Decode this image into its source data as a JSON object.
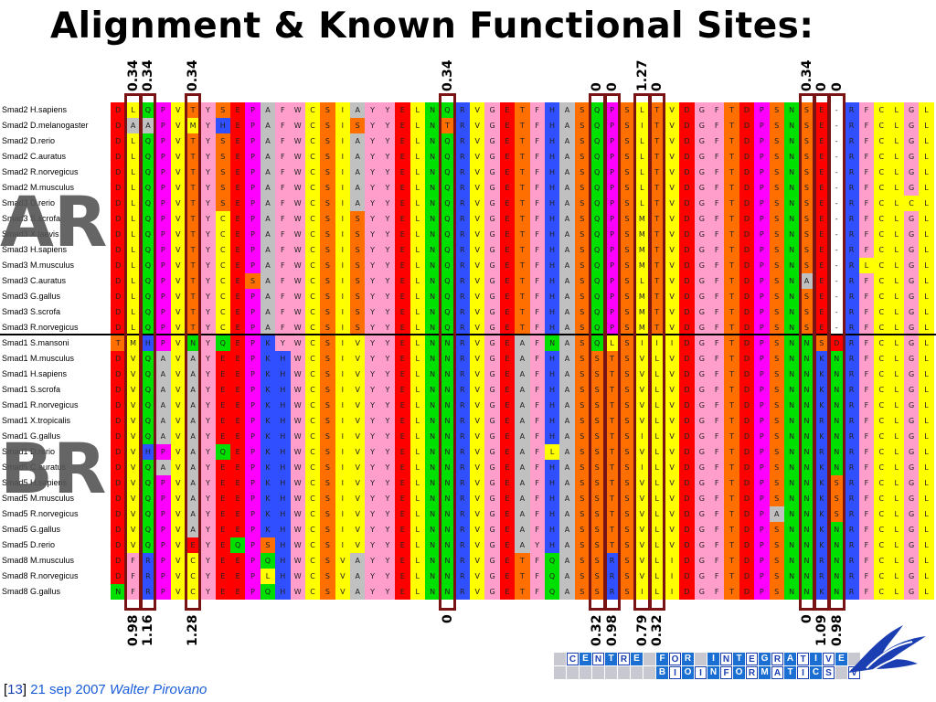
{
  "slide": {
    "title": "Alignment & Known Functional Sites:",
    "group_labels": [
      "AR",
      "BR"
    ],
    "footer": {
      "bracket_open": "[",
      "slide_number": "13",
      "bracket_close": "]",
      "date": "21 sep 2007",
      "author": "Walter Pirovano"
    },
    "logo": {
      "row1": "CENTRE FOR INTEGRATIVE",
      "row2": "BIOINFORMATICS VU"
    }
  },
  "colors": {
    "D": "#ff0000",
    "E": "#ff0000",
    "L": "#ffff00",
    "I": "#ffff00",
    "V": "#ffff00",
    "M": "#ffff00",
    "Q": "#00e000",
    "N": "#00e000",
    "P": "#ff00ff",
    "T": "#ff6f00",
    "S": "#ff6f00",
    "A": "#c0c0c0",
    "C": "#ffff00",
    "F": "#ff9ecb",
    "W": "#ff9ecb",
    "Y": "#ff9ecb",
    "R": "#3050ff",
    "K": "#3050ff",
    "H": "#3050ff",
    "G": "#ff9ecb",
    "-": "#ffffff"
  },
  "alignment": {
    "sequences": [
      {
        "name": "Smad2 H.sapiens",
        "seq": "DLQPVTYSEPAFWCSIAYYELNQRVGETFHASQPSLTVDGFTDPSNSE-RFCLGL"
      },
      {
        "name": "Smad2 D.melanogaster",
        "seq": "DAAPVMYHEPAFWCSISYYELNTRVGETFHASQPSITVDGFTDPSNSE-RFCLGL"
      },
      {
        "name": "Smad2 D.rerio",
        "seq": "DLQPVTYSEPAFWCSIAYYELNQRVGETFHASQPSLTVDGFTDPSNSE-RFCLGL"
      },
      {
        "name": "Smad2 C.auratus",
        "seq": "DLQPVTYSEPAFWCSIAYYELNQRVGETFHASQPSLTVDGFTDPSNSE-RFCLGL"
      },
      {
        "name": "Smad2 R.norvegicus",
        "seq": "DLQPVTYSEPAFWCSIAYYELNQRVGETFHASQPSLTVDGFTDPSNSE-RFCLGL"
      },
      {
        "name": "Smad2 M.musculus",
        "seq": "DLQPVTYSEPAFWCSIAYYELNQRVGETFHASQPSLTVDGFTDPSNSE-RFCLGL"
      },
      {
        "name": "Smad3 D.rerio",
        "seq": "DLQPVTYSEPAFWCSIAYYELNQRVGETFHASQPSLTVDGFTDPSNSE-RFCLCL"
      },
      {
        "name": "Smad3 S.scrofa",
        "seq": "DLQPVTYCEPAFWCSISYYELNQRVGETFHASQPSMTVDGFTDPSNSE-RFCLGL"
      },
      {
        "name": "Smad3 X.laevis",
        "seq": "DLQPVTYCEPAFWCSISYYELNQRVGETFHASQPSMTVDGFTDPSNSE-RFCLGL"
      },
      {
        "name": "Smad3 H.sapiens",
        "seq": "DLQPVTYCEPAFWCSISYYELNQRVGETFHASQPSMTVDGFTDPSNSE-RFCLGL"
      },
      {
        "name": "Smad3 M.musculus",
        "seq": "DLQPVTYCEPAFWCSISYYELNQRVGETFHASQPSMTVDGFTDPSNSE-RLCLGL"
      },
      {
        "name": "Smad3 C.auratus",
        "seq": "DLQPVTYCESAFWCSISYYELNQRVGETFHASQPSLTVDGFTDPSNAE-RFCLGL"
      },
      {
        "name": "Smad3 G.gallus",
        "seq": "DLQPVTYCEPAFWCSISYYELNQRVGETFHASQPSMTVDGFTDPSNSE-RFCLGL"
      },
      {
        "name": "Smad3 S.scrofa",
        "seq": "DLQPVTYCEPAFWCSISYYELNQRVGETFHASQPSMTVDGFTDPSNSE-RFCLGL"
      },
      {
        "name": "Smad3 R.norvegicus",
        "seq": "DLQPVTYCEPAFWCSISYYELNQRVGETFHASQPSMTVDGFTDPSNSE-RFCLGL"
      },
      {
        "name": "Smad1 S.mansoni",
        "seq": "TMHPVNYQEPKYWCSIVYYELNNRVGEAFNASQLSIIIDGFTDPSNNSDRFCLGL"
      },
      {
        "name": "Smad1 M.musculus",
        "seq": "DVQAVAYEEPKHWCSIVYYELNNRVGEAFHASSTSVLVDGFTDPSNNKNRFCLGL"
      },
      {
        "name": "Smad1 H.sapiens",
        "seq": "DVQAVAYEEPKHWCSIVYYELNNRVGEAFHASSTSVLVDGFTDPSNNKNRFCLGL"
      },
      {
        "name": "Smad1 S.scrofa",
        "seq": "DVQAVAYEEPKHWCSIVYYELNNRVGEAFHASSTSVLVDGFTDPSNNKNRFCLGL"
      },
      {
        "name": "Smad1 R.norvegicus",
        "seq": "DVQAVAYEEPKHWCSIVYYELNNRVGEAFHASSTSVLVDGFTDPSNNKNRFCLGL"
      },
      {
        "name": "Smad1 X.tropicalis",
        "seq": "DVQAVAYEEPKHWCSIVYYELNNRVGEAFHASSTSVLVDGFTDPSNNRNRFCLGL"
      },
      {
        "name": "Smad1 G.gallus",
        "seq": "DVQAVAYEEPKHWCSIVYYELNNRVGEAFHASSTSILVDGFTDPSNNKNRFCLGL"
      },
      {
        "name": "Smad1 D.rerio",
        "seq": "DVHPVAYQEPKHWCSIVYYELNNRVGEAFLASSTSVLVDGFTDPSNNRNRFCLGL"
      },
      {
        "name": "Smad5 C.auratus",
        "seq": "DVQAVAYEEPKHWCSIVYYELNNRVGEAFHASSTSILVDGFTDPSNNKNRFCLGL"
      },
      {
        "name": "Smad5 H.sapiens",
        "seq": "DVQPVAYEEPKHWCSIVYYELNNRVGEAFHASSTSVLVDGFTDPSNNKSRFCLGL"
      },
      {
        "name": "Smad5 M.musculus",
        "seq": "DVQPVAYEEPKHWCSIVYYELNNRVGEAFHASSTSVLVDGFTDPSNNKSRFCLGL"
      },
      {
        "name": "Smad5 R.norvegicus",
        "seq": "DVQPVAYEEPKHWCSIVYYELNNRVGEAFHASSTSVLVDGFTDPANNKSRFCLGL"
      },
      {
        "name": "Smad5 G.gallus",
        "seq": "DVQPVAYEEPKHWCSIVYYELNNRVGEAFHASSTSVLVDGFTDPSNNKNRFCLGL"
      },
      {
        "name": "Smad5 D.rerio",
        "seq": "DVQPVEYEQPSHWCSIVYYELNNRVGEAYHASSTSVLVDGFTDPSNNKNRFCLGL"
      },
      {
        "name": "Smad8 M.musculus",
        "seq": "DFRPVCYEEPQHWCSVAYYELNNRVGETFQASSRSVLIDGFTDPSNNRNRFCLGL"
      },
      {
        "name": "Smad8 R.norvegicus",
        "seq": "DFRPVCYEEPLHWCSVAYYELNNRVGETFQASSRSVLIDGFTDPSNNRNRFCLGL"
      },
      {
        "name": "Smad8 G.gallus",
        "seq": "NFRPVCYEEPQHWCSVAYYELNNRVGETFQASSRSILIDGFTDPSNNKNRFCLGL"
      }
    ],
    "top_scores": [
      {
        "col": 1,
        "labels": [
          "0.34"
        ]
      },
      {
        "col": 2,
        "labels": [
          "0.34"
        ]
      },
      {
        "col": 5,
        "labels": [
          "0.34"
        ]
      },
      {
        "col": 22,
        "labels": [
          "0.34"
        ]
      },
      {
        "col": 32,
        "labels": [
          "0"
        ]
      },
      {
        "col": 33,
        "labels": [
          "0"
        ]
      },
      {
        "col": 35,
        "labels": [
          "1.27"
        ]
      },
      {
        "col": 36,
        "labels": [
          "0"
        ]
      },
      {
        "col": 46,
        "labels": [
          "0.34"
        ]
      },
      {
        "col": 47,
        "labels": [
          "0"
        ]
      },
      {
        "col": 48,
        "labels": [
          "0"
        ]
      }
    ],
    "bottom_scores": [
      {
        "col": 1,
        "labels": [
          "0.98"
        ]
      },
      {
        "col": 2,
        "labels": [
          "1.16"
        ]
      },
      {
        "col": 5,
        "labels": [
          "1.28"
        ]
      },
      {
        "col": 22,
        "labels": [
          "0"
        ]
      },
      {
        "col": 32,
        "labels": [
          "0.32"
        ]
      },
      {
        "col": 33,
        "labels": [
          "0.98"
        ]
      },
      {
        "col": 35,
        "labels": [
          "0.79"
        ]
      },
      {
        "col": 36,
        "labels": [
          "0.32"
        ]
      },
      {
        "col": 46,
        "labels": [
          "0"
        ]
      },
      {
        "col": 47,
        "labels": [
          "1.09"
        ]
      },
      {
        "col": 48,
        "labels": [
          "0.98"
        ]
      }
    ]
  }
}
